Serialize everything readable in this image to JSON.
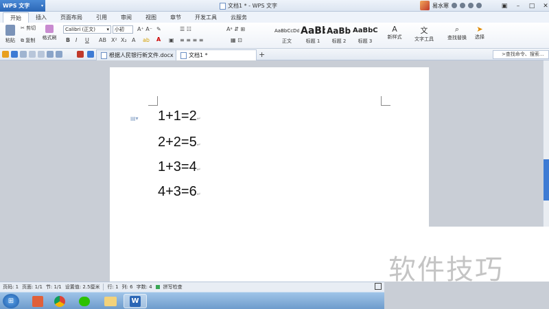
{
  "app": {
    "name": "WPS 文字",
    "window_title": "文档1 * - WPS 文字",
    "user_name": "易水寒"
  },
  "menu_tabs": [
    "开始",
    "插入",
    "页面布局",
    "引用",
    "审阅",
    "视图",
    "章节",
    "开发工具",
    "云服务"
  ],
  "ribbon": {
    "paste_label": "粘贴",
    "cut_label": "剪切",
    "copy_label": "复制",
    "format_painter_label": "格式刷",
    "font_name": "Calibri (正文)",
    "font_size": "小初",
    "styles": [
      {
        "preview": "AaBbCcDd",
        "label": "正文"
      },
      {
        "preview": "AaBb",
        "label": "标题 1"
      },
      {
        "preview": "AaBb(",
        "label": "标题 2"
      },
      {
        "preview": "AaBbC",
        "label": "标题 3"
      }
    ],
    "new_style_label": "新样式",
    "text_tools_label": "文字工具",
    "find_replace_label": "查找替换",
    "select_label": "选择"
  },
  "doc_tabs": [
    {
      "label": "根据人民银行新文件.docx",
      "active": false
    },
    {
      "label": "文档1 *",
      "active": true
    }
  ],
  "search_placeholder": ">查找命令、搜索...",
  "document_lines": [
    "1+1=2",
    "2+2=5",
    "1+3=4",
    "4+3=6"
  ],
  "status_bar": {
    "page_num": "页码: 1",
    "pages": "页面: 1/1",
    "section": "节: 1/1",
    "position": "设置值: 2.5厘米",
    "row": "行: 1",
    "col": "列: 6",
    "words": "字数: 4",
    "spell_check": "拼写检查"
  },
  "watermark": "软件技巧",
  "colors": {
    "accent": "#2b66b5",
    "scroll_thumb": "#3d7bd4"
  }
}
